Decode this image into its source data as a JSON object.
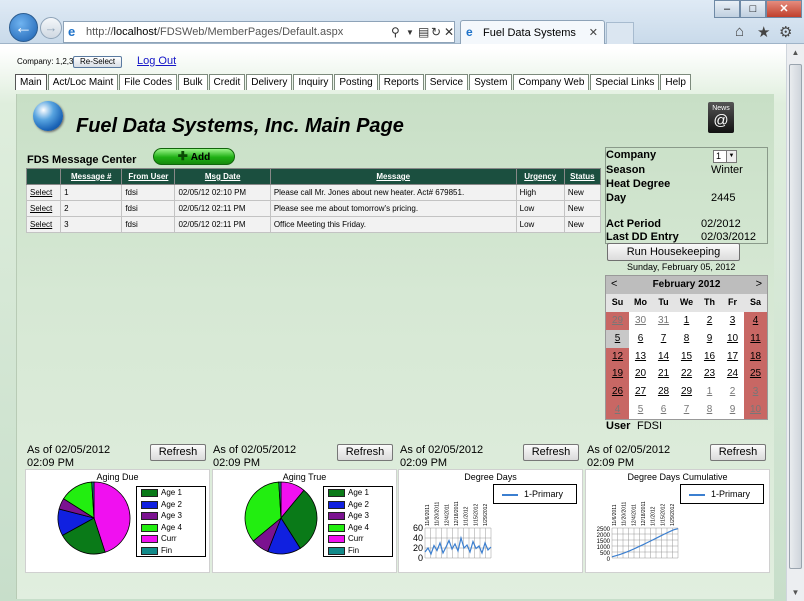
{
  "browser": {
    "address_prefix": "http://",
    "address_host": "localhost",
    "address_path": "/FDSWeb/MemberPages/Default.aspx",
    "tab_title": "Fuel Data Systems"
  },
  "header": {
    "company_label": "Company: 1,2,3",
    "reselect_label": "Re-Select",
    "logout_label": "Log Out"
  },
  "menu": [
    "Main",
    "Act/Loc Maint",
    "File Codes",
    "Bulk",
    "Credit",
    "Delivery",
    "Inquiry",
    "Posting",
    "Reports",
    "Service",
    "System",
    "Company Web",
    "Special Links",
    "Help"
  ],
  "page_title": "Fuel Data Systems, Inc. Main Page",
  "news_icon": {
    "label": "News",
    "symbol": "@"
  },
  "message_center": {
    "title": "FDS Message Center",
    "add_label": "Add",
    "columns": [
      "",
      "Message #",
      "From User",
      "Msg Date",
      "Message",
      "Urgency",
      "Status"
    ],
    "rows": [
      {
        "select": "Select",
        "num": "1",
        "from": "fdsi",
        "date": "02/05/12 02:10 PM",
        "message": "Please call Mr. Jones about new heater. Act# 679851.",
        "urgency": "High",
        "status": "New"
      },
      {
        "select": "Select",
        "num": "2",
        "from": "fdsi",
        "date": "02/05/12 02:11 PM",
        "message": "Please see me about tomorrow's pricing.",
        "urgency": "Low",
        "status": "New"
      },
      {
        "select": "Select",
        "num": "3",
        "from": "fdsi",
        "date": "02/05/12 02:11 PM",
        "message": "Office Meeting this Friday.",
        "urgency": "Low",
        "status": "New"
      }
    ]
  },
  "info": {
    "company_label": "Company",
    "company_value": "1",
    "season_label": "Season",
    "season_value": "Winter",
    "hdd_label_1": "Heat Degree",
    "hdd_label_2": "Day",
    "hdd_value": "2445",
    "act_period_label": "Act Period",
    "act_period_value": "02/2012",
    "last_dd_label": "Last DD Entry",
    "last_dd_value": "02/03/2012",
    "housekeeping_label": "Run Housekeeping"
  },
  "calendar": {
    "date_label": "Sunday, February 05, 2012",
    "title": "February 2012",
    "prev": "<",
    "next": ">",
    "dows": [
      "Su",
      "Mo",
      "Tu",
      "We",
      "Th",
      "Fr",
      "Sa"
    ],
    "weeks": [
      [
        "29",
        "30",
        "31",
        "1",
        "2",
        "3",
        "4"
      ],
      [
        "5",
        "6",
        "7",
        "8",
        "9",
        "10",
        "11"
      ],
      [
        "12",
        "13",
        "14",
        "15",
        "16",
        "17",
        "18"
      ],
      [
        "19",
        "20",
        "21",
        "22",
        "23",
        "24",
        "25"
      ],
      [
        "26",
        "27",
        "28",
        "29",
        "1",
        "2",
        "3"
      ],
      [
        "4",
        "5",
        "6",
        "7",
        "8",
        "9",
        "10"
      ]
    ],
    "user_label": "User",
    "user_value": "FDSI"
  },
  "widgets": [
    {
      "date": "As of 02/05/2012",
      "time": "02:09 PM",
      "refresh": "Refresh",
      "chart_title": "Aging Due"
    },
    {
      "date": "As of 02/05/2012",
      "time": "02:09 PM",
      "refresh": "Refresh",
      "chart_title": "Aging True"
    },
    {
      "date": "As of 02/05/2012",
      "time": "02:09 PM",
      "refresh": "Refresh",
      "chart_title": "Degree Days"
    },
    {
      "date": "As of 02/05/2012",
      "time": "02:09 PM",
      "refresh": "Refresh",
      "chart_title": "Degree Days Cumulative"
    }
  ],
  "legend_items": [
    {
      "name": "Age 1",
      "color": "#0a7a18"
    },
    {
      "name": "Age 2",
      "color": "#1020e0"
    },
    {
      "name": "Age 3",
      "color": "#7b1290"
    },
    {
      "name": "Age 4",
      "color": "#22ee10"
    },
    {
      "name": "Curr",
      "color": "#f010f0"
    },
    {
      "name": "Fin",
      "color": "#128a8a"
    }
  ],
  "line_legend": "1-Primary",
  "chart_data": [
    {
      "type": "pie",
      "title": "Aging Due",
      "categories": [
        "Age 1",
        "Age 2",
        "Age 3",
        "Age 4",
        "Curr",
        "Fin"
      ],
      "values": [
        22,
        12,
        5,
        15,
        45,
        1
      ]
    },
    {
      "type": "pie",
      "title": "Aging True",
      "categories": [
        "Age 1",
        "Age 2",
        "Age 3",
        "Age 4",
        "Curr",
        "Fin"
      ],
      "values": [
        30,
        15,
        8,
        35,
        11,
        1
      ]
    },
    {
      "type": "line",
      "title": "Degree Days",
      "series": [
        {
          "name": "1-Primary",
          "values": [
            12,
            20,
            8,
            25,
            15,
            30,
            10,
            22,
            35,
            18,
            28,
            14,
            40,
            20,
            26,
            12,
            33,
            19,
            24,
            10,
            30,
            16,
            22
          ]
        }
      ],
      "yticks": [
        "60",
        "40",
        "20",
        "0"
      ],
      "xticks": [
        "11/6/2011",
        "11/20/2011",
        "12/4/2011",
        "12/18/2011",
        "1/1/2012",
        "1/15/2012",
        "1/29/2012"
      ]
    },
    {
      "type": "line",
      "title": "Degree Days Cumulative",
      "series": [
        {
          "name": "1-Primary",
          "values": [
            100,
            200,
            320,
            450,
            600,
            760,
            930,
            1100,
            1280,
            1460,
            1640,
            1830,
            2010,
            2180,
            2350,
            2445
          ]
        }
      ],
      "yticks": [
        "2500",
        "2000",
        "1500",
        "1000",
        "500",
        "0"
      ],
      "xticks": [
        "11/6/2011",
        "11/20/2011",
        "12/4/2011",
        "12/18/2011",
        "1/1/2012",
        "1/15/2012",
        "1/29/2012"
      ]
    }
  ]
}
